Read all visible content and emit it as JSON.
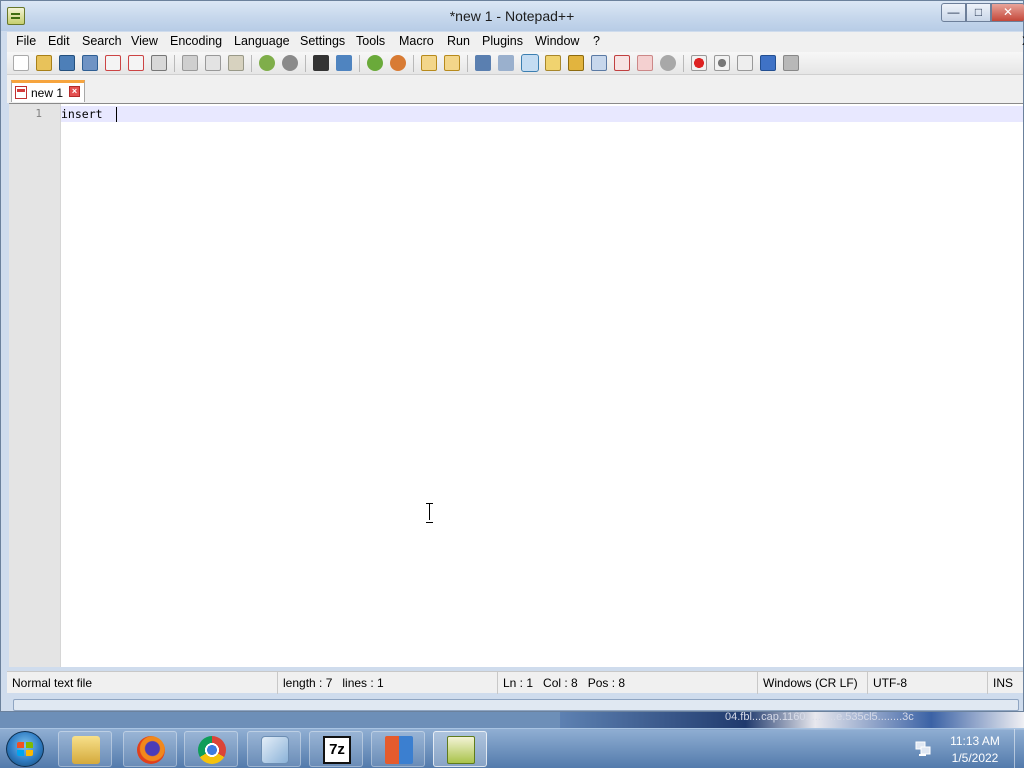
{
  "window": {
    "title": "*new 1 - Notepad++"
  },
  "caption_buttons": {
    "minimize": "—",
    "maximize": "□",
    "close": "✕"
  },
  "menu": {
    "items": [
      "File",
      "Edit",
      "Search",
      "View",
      "Encoding",
      "Language",
      "Settings",
      "Tools",
      "Macro",
      "Run",
      "Plugins",
      "Window",
      "?"
    ],
    "close_document": "X"
  },
  "toolbar": {
    "icons": [
      "new-file-icon",
      "open-file-icon",
      "save-icon",
      "save-all-icon",
      "close-icon",
      "close-all-icon",
      "print-icon",
      "cut-icon",
      "copy-icon",
      "paste-icon",
      "undo-icon",
      "redo-icon",
      "find-icon",
      "replace-icon",
      "zoom-in-icon",
      "zoom-out-icon",
      "sync-vertical-icon",
      "sync-horizontal-icon",
      "word-wrap-icon",
      "show-all-characters-icon",
      "indent-guide-icon",
      "doc-map-icon",
      "function-list-icon",
      "folder-workspace-icon",
      "monitoring-icon",
      "record-macro-icon",
      "stop-recording-icon",
      "playback-macro-icon",
      "run-macro-multiple-icon",
      "save-macro-icon"
    ],
    "active_icon": "indent-guide-icon"
  },
  "tabs": [
    {
      "label": "new 1",
      "modified": true
    }
  ],
  "editor": {
    "lines": [
      {
        "number": "1",
        "text": "insert "
      }
    ]
  },
  "status": {
    "file_type": "Normal text file",
    "length": "length : 7",
    "lines": "lines : 1",
    "ln": "Ln : 1",
    "col": "Col : 8",
    "pos": "Pos : 8",
    "eol": "Windows (CR LF)",
    "encoding": "UTF-8",
    "mode": "INS"
  },
  "desktop": {
    "background_text": "04.fbl...cap.1160..........e.535cl5........3c"
  },
  "taskbar": {
    "apps": [
      "windows-explorer-icon",
      "firefox-icon",
      "chrome-icon",
      "app-icon",
      "7zip-icon",
      "app-icon",
      "notepadpp-icon"
    ],
    "active_app": "notepadpp-icon",
    "clock_time": "11:13 AM",
    "clock_date": "1/5/2022"
  },
  "colors": {
    "titlebar": "#c6d7ec",
    "current_line_highlight": "#e8e8ff",
    "gutter": "#e4e4e4",
    "tab_accent": "#f6a43e"
  }
}
